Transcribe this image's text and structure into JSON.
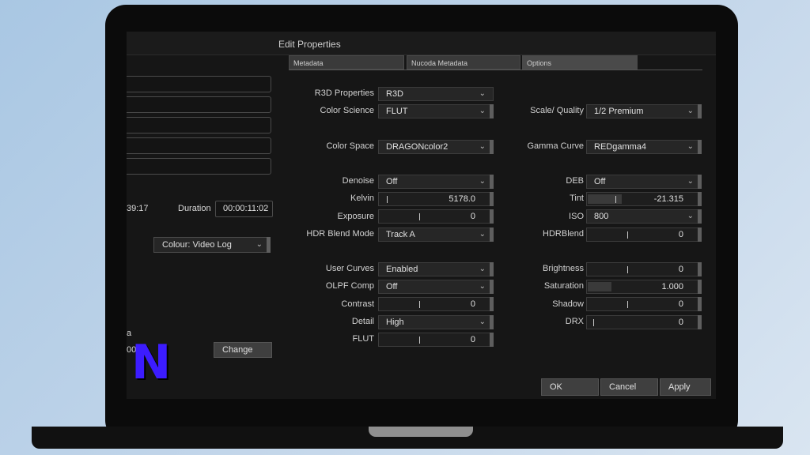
{
  "window": {
    "title": "Edit Properties"
  },
  "tabs": [
    {
      "label": "Metadata",
      "active": false
    },
    {
      "label": "Nucoda Metadata",
      "active": false
    },
    {
      "label": "Options",
      "active": true
    }
  ],
  "left_panel": {
    "timecode_in": "39:17",
    "duration_label": "Duration",
    "duration_value": "00:00:11:02",
    "colour_select": "Colour: Video Log",
    "partial_label": "a",
    "partial_value": "00",
    "change_button": "Change",
    "logo_letter": "N"
  },
  "left_column": {
    "r3d_properties": {
      "label": "R3D Properties",
      "value": "R3D"
    },
    "color_science": {
      "label": "Color Science",
      "value": "FLUT"
    },
    "color_space": {
      "label": "Color Space",
      "value": "DRAGONcolor2"
    },
    "denoise": {
      "label": "Denoise",
      "value": "Off"
    },
    "kelvin": {
      "label": "Kelvin",
      "value": "5178.0"
    },
    "exposure": {
      "label": "Exposure",
      "value": "0"
    },
    "hdr_blend_mode": {
      "label": "HDR Blend Mode",
      "value": "Track A"
    },
    "user_curves": {
      "label": "User Curves",
      "value": "Enabled"
    },
    "olpf_comp": {
      "label": "OLPF Comp",
      "value": "Off"
    },
    "contrast": {
      "label": "Contrast",
      "value": "0"
    },
    "detail": {
      "label": "Detail",
      "value": "High"
    },
    "flut": {
      "label": "FLUT",
      "value": "0"
    }
  },
  "right_column": {
    "scale_quality": {
      "label": "Scale/ Quality",
      "value": "1/2 Premium"
    },
    "gamma_curve": {
      "label": "Gamma Curve",
      "value": "REDgamma4"
    },
    "deb": {
      "label": "DEB",
      "value": "Off"
    },
    "tint": {
      "label": "Tint",
      "value": "-21.315"
    },
    "iso": {
      "label": "ISO",
      "value": "800"
    },
    "hdr_blend": {
      "label": "HDRBlend",
      "value": "0"
    },
    "brightness": {
      "label": "Brightness",
      "value": "0"
    },
    "saturation": {
      "label": "Saturation",
      "value": "1.000"
    },
    "shadow": {
      "label": "Shadow",
      "value": "0"
    },
    "drx": {
      "label": "DRX",
      "value": "0"
    }
  },
  "footer": {
    "ok": "OK",
    "cancel": "Cancel",
    "apply": "Apply"
  },
  "icons": {
    "dropdown": "chevron-down-icon",
    "slider": "slider-tick-icon"
  },
  "colors": {
    "background": "#161616",
    "panel_field": "#1e1e1e",
    "logo": "#3c1cff"
  }
}
